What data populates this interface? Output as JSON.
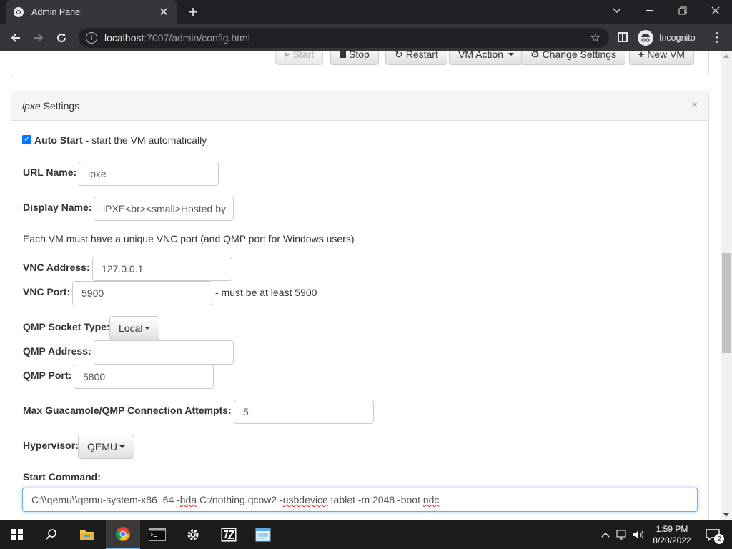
{
  "browser": {
    "tab_title": "Admin Panel",
    "url_host": "localhost",
    "url_path": ":7007/admin/config.html",
    "profile_label": "Incognito"
  },
  "toolbar_buttons": {
    "start": "Start",
    "stop": "Stop",
    "restart": "Restart",
    "vm_action": "VM Action",
    "change_settings": "Change Settings",
    "new_vm": "New VM"
  },
  "panel": {
    "title_italic": "ipxe",
    "title_rest": " Settings",
    "close": "×"
  },
  "form": {
    "auto_start_label": "Auto Start",
    "auto_start_desc": " - start the VM automatically",
    "auto_start_checked": true,
    "url_name_label": "URL Name:",
    "url_name_value": "ipxe",
    "display_name_label": "Display Name:",
    "display_name_value": "iPXE<br><small>Hosted by",
    "vnc_note": "Each VM must have a unique VNC port (and QMP port for Windows users)",
    "vnc_address_label": "VNC Address:",
    "vnc_address_value": "127.0.0.1",
    "vnc_port_label": "VNC Port:",
    "vnc_port_value": "5900",
    "vnc_port_hint": "- must be at least 5900",
    "qmp_socket_type_label": "QMP Socket Type:",
    "qmp_socket_type_value": "Local",
    "qmp_address_label": "QMP Address:",
    "qmp_address_value": "",
    "qmp_port_label": "QMP Port:",
    "qmp_port_value": "5800",
    "max_attempts_label": "Max Guacamole/QMP Connection Attempts:",
    "max_attempts_value": "5",
    "hypervisor_label": "Hypervisor:",
    "hypervisor_value": "QEMU",
    "start_command_label": "Start Command:",
    "start_command_parts": {
      "p1": "C:\\\\qemu\\\\qemu-system-x86_64 -",
      "p2": "hda",
      "p3": " C:/nothing.qcow2 -",
      "p4": "usbdevice",
      "p5": " tablet -m 2048 -boot ",
      "p6": "ndc"
    }
  },
  "taskbar": {
    "time": "1:59 PM",
    "date": "8/20/2022",
    "notification_count": "2"
  },
  "colors": {
    "chrome_dark": "#202124",
    "chrome_toolbar": "#35363a",
    "checkbox_blue": "#0075ff",
    "focus_blue": "#66afe9",
    "taskbar": "#1c1c1c"
  },
  "icons": [
    "chrome-favicon-icon",
    "close-tab-icon",
    "new-tab-icon",
    "minimize-icon",
    "maximize-icon",
    "close-window-icon",
    "back-icon",
    "forward-icon",
    "reload-icon",
    "info-icon",
    "star-icon",
    "side-panel-icon",
    "incognito-icon",
    "menu-icon",
    "play-icon",
    "stop-icon",
    "refresh-icon",
    "cog-icon",
    "plus-icon",
    "windows-start-icon",
    "search-icon",
    "file-explorer-icon",
    "chrome-icon",
    "terminal-icon",
    "settings-icon",
    "7zip-icon",
    "notepad-icon",
    "chevron-up-icon",
    "network-icon",
    "volume-icon",
    "notification-icon"
  ]
}
